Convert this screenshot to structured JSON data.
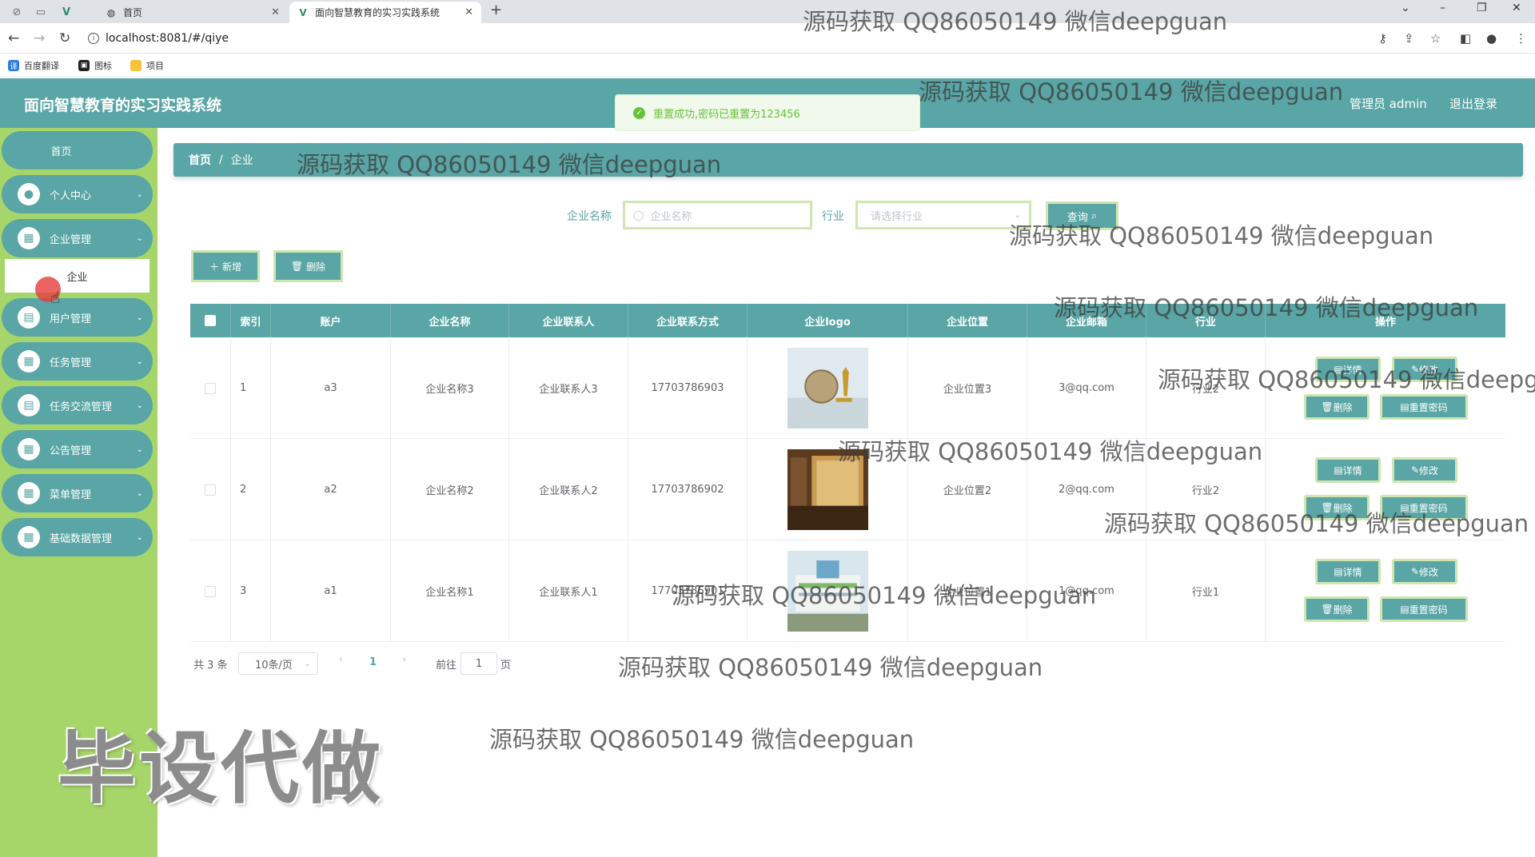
{
  "browser": {
    "tabs": [
      {
        "title": "首页",
        "active": false
      },
      {
        "title": "面向智慧教育的实习实践系统",
        "active": true
      }
    ],
    "url": "localhost:8081/#/qiye",
    "bookmarks": [
      "百度翻译",
      "图标",
      "项目"
    ]
  },
  "header": {
    "title": "面向智慧教育的实习实践系统",
    "admin": "管理员 admin",
    "logout": "退出登录"
  },
  "toast": {
    "message": "重置成功,密码已重置为123456"
  },
  "sidebar": {
    "items": [
      {
        "label": "首页"
      },
      {
        "label": "个人中心"
      },
      {
        "label": "企业管理"
      },
      {
        "label": "企业"
      },
      {
        "label": "用户管理"
      },
      {
        "label": "任务管理"
      },
      {
        "label": "任务交流管理"
      },
      {
        "label": "公告管理"
      },
      {
        "label": "菜单管理"
      },
      {
        "label": "基础数据管理"
      }
    ]
  },
  "breadcrumb": {
    "home": "首页",
    "sep": "/",
    "current": "企业"
  },
  "search": {
    "name_label": "企业名称",
    "name_placeholder": "企业名称",
    "industry_label": "行业",
    "industry_placeholder": "请选择行业",
    "query_button": "查询"
  },
  "actions": {
    "add": "新增",
    "delete": "删除"
  },
  "table": {
    "columns": [
      "索引",
      "账户",
      "企业名称",
      "企业联系人",
      "企业联系方式",
      "企业logo",
      "企业位置",
      "企业邮箱",
      "行业",
      "操作"
    ],
    "rows": [
      {
        "index": "1",
        "account": "a3",
        "name": "企业名称3",
        "contact": "企业联系人3",
        "phone": "17703786903",
        "location": "企业位置3",
        "email": "3@qq.com",
        "industry": "行业2"
      },
      {
        "index": "2",
        "account": "a2",
        "name": "企业名称2",
        "contact": "企业联系人2",
        "phone": "17703786902",
        "location": "企业位置2",
        "email": "2@qq.com",
        "industry": "行业2"
      },
      {
        "index": "3",
        "account": "a1",
        "name": "企业名称1",
        "contact": "企业联系人1",
        "phone": "17703786901",
        "location": "企业位置1",
        "email": "1@qq.com",
        "industry": "行业1"
      }
    ],
    "ops": {
      "detail": "详情",
      "edit": "修改",
      "delete": "删除",
      "reset": "重置密码"
    }
  },
  "pagination": {
    "total": "共 3 条",
    "page_size": "10条/页",
    "current": "1",
    "goto_prefix": "前往",
    "goto_value": "1",
    "goto_suffix": "页"
  },
  "watermark": {
    "text": "源码获取 QQ86050149 微信deepguan",
    "big": "毕设代做"
  },
  "colors": {
    "primary": "#5aa5a5",
    "sidebar": "#a6d56a",
    "button_border": "#cfe6b0",
    "toast_bg": "#f0f9eb",
    "toast_text": "#67c23a"
  }
}
